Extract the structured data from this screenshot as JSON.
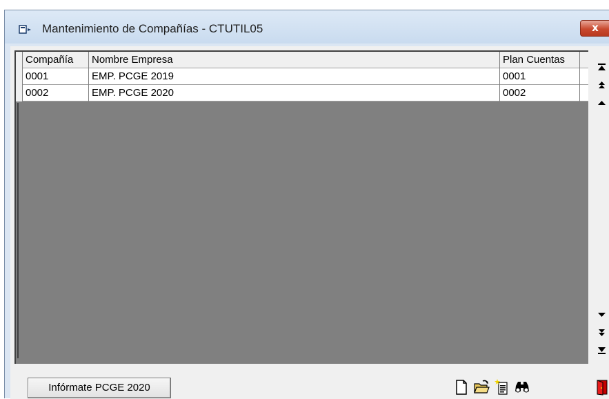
{
  "window": {
    "title": "Mantenimiento de Compañías - CTUTIL05",
    "close_label": "x"
  },
  "grid": {
    "columns": [
      "Compañía",
      "Nombre Empresa",
      "Plan Cuentas"
    ],
    "rows": [
      {
        "compania": "0001",
        "nombre": "EMP. PCGE 2019",
        "plan": "0001"
      },
      {
        "compania": "0002",
        "nombre": "EMP. PCGE 2020",
        "plan": "0002"
      }
    ]
  },
  "scrollbar": {
    "buttons": [
      "first-page-icon",
      "page-up-icon",
      "line-up-icon",
      "line-down-icon",
      "page-down-icon",
      "last-page-icon"
    ]
  },
  "toolbar": {
    "info_button_label": "Infórmate PCGE 2020",
    "icons": [
      "new-document-icon",
      "open-folder-icon",
      "new-record-icon",
      "binoculars-icon",
      "exit-door-icon"
    ]
  }
}
